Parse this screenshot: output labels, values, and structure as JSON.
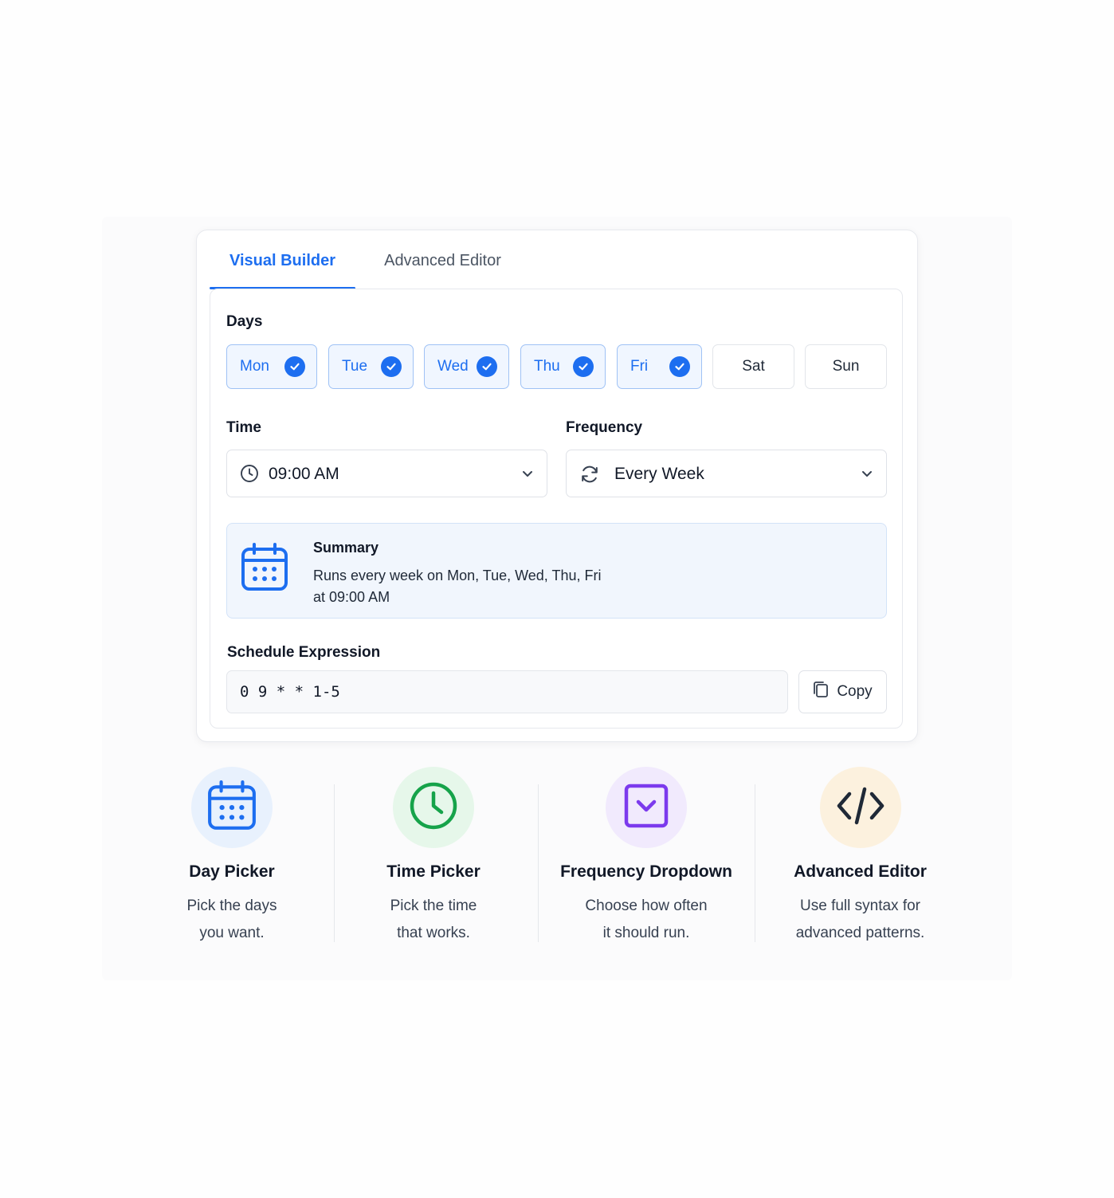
{
  "tabs": [
    {
      "label": "Visual Builder",
      "active": true
    },
    {
      "label": "Advanced Editor",
      "active": false
    }
  ],
  "days": {
    "label": "Days",
    "items": [
      {
        "label": "Mon",
        "selected": true
      },
      {
        "label": "Tue",
        "selected": true
      },
      {
        "label": "Wed",
        "selected": true
      },
      {
        "label": "Thu",
        "selected": true
      },
      {
        "label": "Fri",
        "selected": true
      },
      {
        "label": "Sat",
        "selected": false
      },
      {
        "label": "Sun",
        "selected": false
      }
    ]
  },
  "time": {
    "label": "Time",
    "value": "09:00 AM",
    "icon": "clock-icon"
  },
  "frequency": {
    "label": "Frequency",
    "value": "Every Week",
    "icon": "refresh-icon"
  },
  "summary": {
    "title": "Summary",
    "line1": "Runs every week on Mon, Tue, Wed, Thu, Fri",
    "line2": "at 09:00 AM",
    "icon": "calendar-icon"
  },
  "schedule": {
    "label": "Schedule Expression",
    "value": "0 9 * * 1-5",
    "copy_label": "Copy"
  },
  "features": [
    {
      "title": "Day Picker",
      "desc1": "Pick the days",
      "desc2": "you want.",
      "icon": "calendar-icon",
      "color": "#1d6ef0",
      "bg": "#e8f1fd"
    },
    {
      "title": "Time Picker",
      "desc1": "Pick the time",
      "desc2": "that works.",
      "icon": "clock-icon",
      "color": "#16a34a",
      "bg": "#e6f7ea"
    },
    {
      "title": "Frequency Dropdown",
      "desc1": "Choose how often",
      "desc2": "it should run.",
      "icon": "dropdown-icon",
      "color": "#7c3aed",
      "bg": "#f1eafd"
    },
    {
      "title": "Advanced Editor",
      "desc1": "Use full syntax for",
      "desc2": "advanced patterns.",
      "icon": "code-icon",
      "color": "#1f2937",
      "bg": "#fcf1de"
    }
  ],
  "colors": {
    "accent": "#1d6ef0",
    "selected_bg": "#f0f6ff",
    "summary_bg": "#f1f6fd"
  }
}
